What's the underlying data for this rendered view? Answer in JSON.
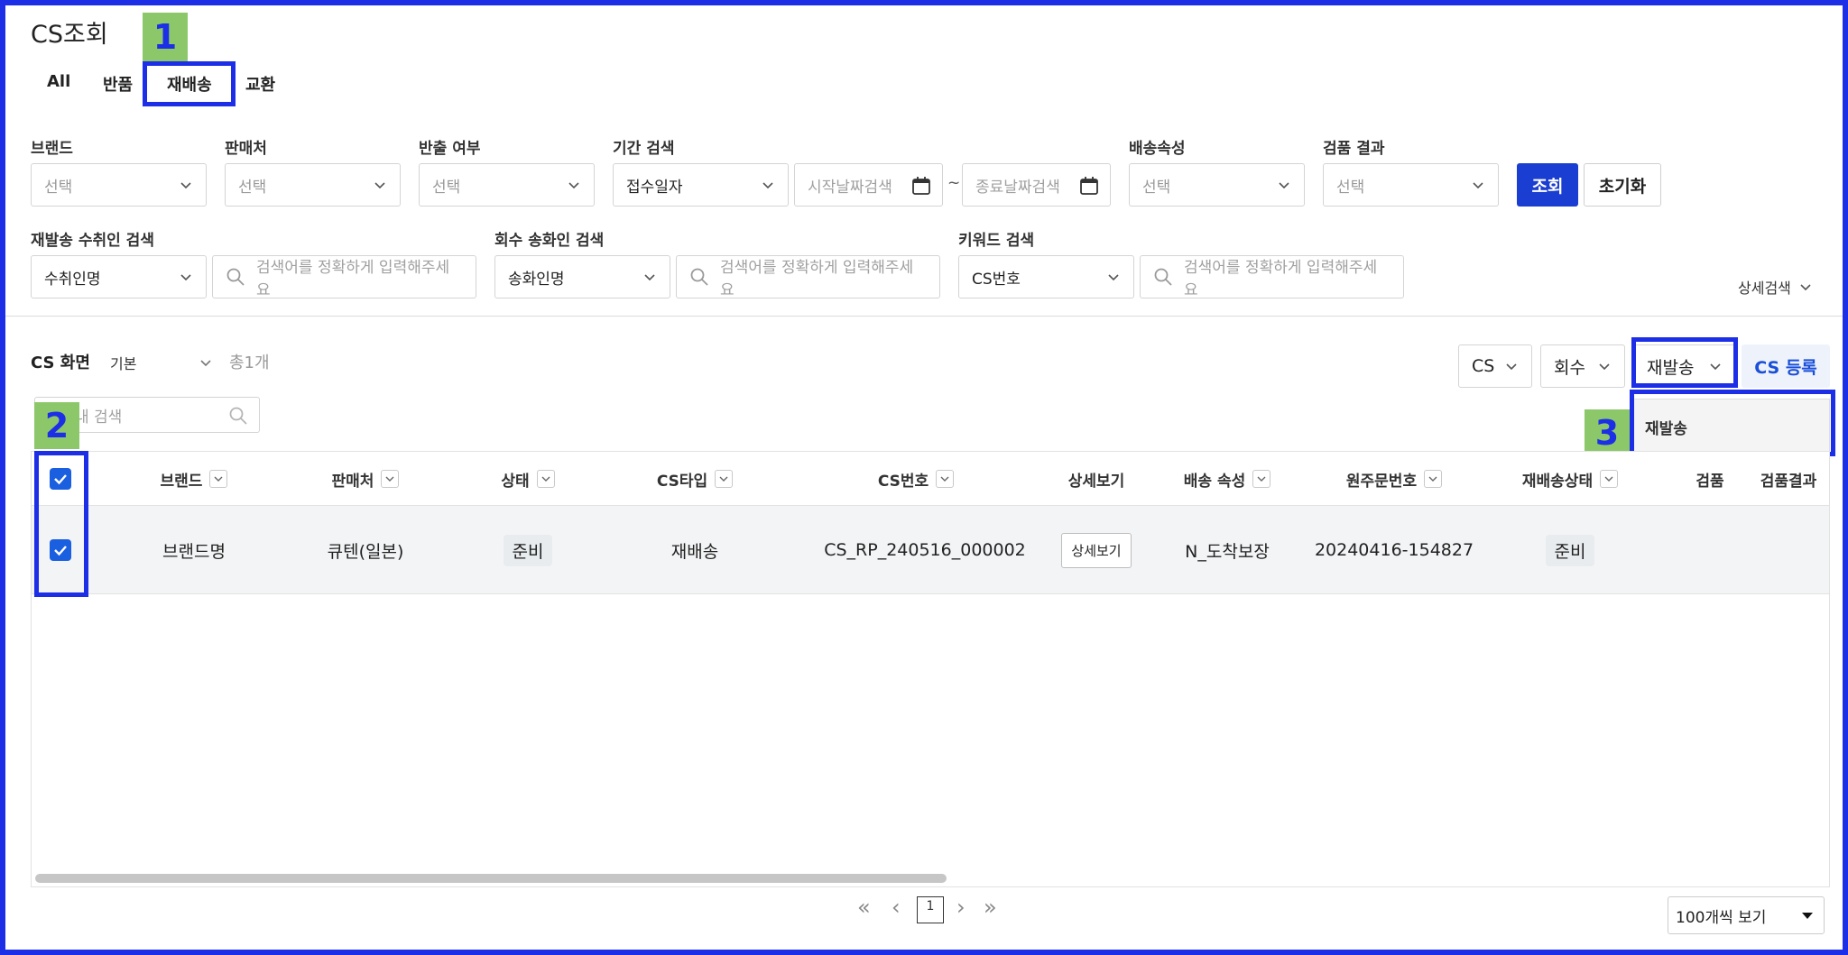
{
  "page_title": "CS조회",
  "tabs": [
    {
      "label": "All"
    },
    {
      "label": "반품"
    },
    {
      "label": "재배송"
    },
    {
      "label": "교환"
    }
  ],
  "markers": [
    "1",
    "2",
    "3"
  ],
  "filters": {
    "brand": {
      "label": "브랜드",
      "value": "선택"
    },
    "seller": {
      "label": "판매처",
      "value": "선택"
    },
    "release": {
      "label": "반출 여부",
      "value": "선택"
    },
    "period": {
      "label": "기간 검색",
      "value": "접수일자",
      "start_placeholder": "시작날짜검색",
      "tilde": "~",
      "end_placeholder": "종료날짜검색"
    },
    "shipping_attr": {
      "label": "배송속성",
      "value": "선택"
    },
    "inspection_result": {
      "label": "검품 결과",
      "value": "선택"
    },
    "search_button": "조회",
    "reset_button": "초기화",
    "resend_recipient": {
      "label": "재발송 수취인 검색",
      "value": "수취인명",
      "placeholder": "검색어를 정확하게 입력해주세요"
    },
    "return_sender": {
      "label": "회수 송화인 검색",
      "value": "송화인명",
      "placeholder": "검색어를 정확하게 입력해주세요"
    },
    "keyword": {
      "label": "키워드 검색",
      "value": "CS번호",
      "placeholder": "검색어를 정확하게 입력해주세요"
    },
    "advanced_search": "상세검색"
  },
  "list_header": {
    "view_label": "CS 화면",
    "view_value": "기본",
    "total": "총1개",
    "result_search_placeholder": "내 검색",
    "cs_select": "CS",
    "return_select": "회수",
    "resend_select": "재발송",
    "register_button": "CS 등록",
    "dropdown_option": "재발송"
  },
  "table": {
    "columns": [
      "브랜드",
      "판매처",
      "상태",
      "CS타입",
      "CS번호",
      "상세보기",
      "배송 속성",
      "원주문번호",
      "재배송상태",
      "검품",
      "검품결과"
    ],
    "rows": [
      {
        "brand": "브랜드명",
        "seller": "큐텐(일본)",
        "status": "준비",
        "cs_type": "재배송",
        "cs_number": "CS_RP_240516_000002",
        "detail_button": "상세보기",
        "shipping_attr": "N_도착보장",
        "order_number": "20240416-154827",
        "resend_status": "준비",
        "inspection": "",
        "inspection_result": ""
      }
    ]
  },
  "pagination": {
    "first": "«",
    "prev": "‹",
    "current": "1",
    "next": "›",
    "last": "»",
    "per_page": "100개씩 보기"
  },
  "colors": {
    "highlight": "#1c2ee6",
    "marker_bg": "#8cc86a",
    "primary": "#1a3ed2",
    "checkbox": "#1a5fe0"
  }
}
